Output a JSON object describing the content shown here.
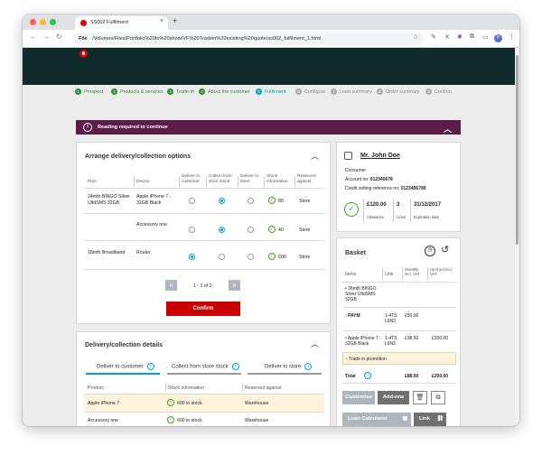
{
  "browser": {
    "tab_title": "SS002 Fulfilment",
    "tab_close": "×",
    "new_tab": "+",
    "url_scheme": "File",
    "url_path": "/Volumes/Files/Portfolio%20to%20show/VF%20Tradein%20existing%20quote/ss002_fulfilment_1.html",
    "profile_initial": "P"
  },
  "colors": {
    "header": "#0f2a2a",
    "alert": "#5c1c4a",
    "brand_red": "#e60000",
    "accent": "#00a3c4",
    "done": "#2e8b2e"
  },
  "steps": [
    {
      "num": "1",
      "label": "Prospect",
      "state": "done"
    },
    {
      "num": "2",
      "label": "Products & services",
      "state": "done"
    },
    {
      "num": "3",
      "label": "Trade-in",
      "state": "done"
    },
    {
      "num": "4",
      "label": "About the customer",
      "state": "done"
    },
    {
      "num": "5",
      "label": "Fulfilment",
      "state": "current"
    },
    {
      "num": "6",
      "label": "Configure",
      "state": "todo"
    },
    {
      "num": "7",
      "label": "Loan summary",
      "state": "todo"
    },
    {
      "num": "8",
      "label": "Order summary",
      "state": "todo"
    },
    {
      "num": "9",
      "label": "Confirm",
      "state": "todo"
    }
  ],
  "alert": {
    "icon": "!",
    "text": "Reading required to continue",
    "chevron": "︿"
  },
  "arrange": {
    "title": "Arrange delivery/collection options",
    "chevron": "︿",
    "headers": {
      "plan": "Plan",
      "device": "Device",
      "deliver_customer": "Deliver to customer",
      "collect_store": "Collect from store stock",
      "deliver_store": "Deliver to store",
      "stock": "Stock information",
      "reserved": "Reserved against"
    },
    "rows": [
      {
        "plan": "24mth BINGO Silver UltdSMS 32GB",
        "device": "Apple iPhone 7 - 32GB Black",
        "selected": "collect",
        "stock": "80",
        "reserved": "Store"
      },
      {
        "plan": "",
        "device": "Accessory one",
        "selected": "collect",
        "stock": "40",
        "reserved": "Store"
      },
      {
        "plan": "18mth Broadband",
        "device": "Router",
        "selected": "deliver_customer",
        "stock": "600",
        "reserved": "Store"
      }
    ],
    "pager": {
      "prev": "«",
      "text": "1 - 2 of 2",
      "next": "»"
    },
    "confirm_label": "Confirm"
  },
  "details": {
    "title": "Delivery/collection details",
    "chevron": "︿",
    "tabs": [
      "Deliver to customer",
      "Collect from store stock",
      "Deliver to store"
    ],
    "active_tab": 0,
    "headers": {
      "product": "Product",
      "stock": "Stock information",
      "reserved": "Reserved against"
    },
    "rows": [
      {
        "product": "Apple iPhone 7",
        "stock": "600 in stock",
        "reserved": "Warehouse"
      },
      {
        "product": "Accessory one",
        "stock": "600 in stock",
        "reserved": "Warehouse"
      }
    ]
  },
  "customer": {
    "name": "Mr. John Doe",
    "type": "Consumer",
    "account_label": "Account no:",
    "account_no": "012345678",
    "credit_label": "Credit  vetting reference no:",
    "credit_ref": "0123456789",
    "allowance_value": "£120.00",
    "allowance_label": "Allowance",
    "lines_value": "3",
    "lines_label": "Lines",
    "expiry_value": "31/12/2017",
    "expiry_label": "Expiration date"
  },
  "basket": {
    "title": "Basket",
    "headers": {
      "items": "Items",
      "link": "Link",
      "monthly": "Monthly incl. VAT",
      "upfront": "Up-front incl. VAT"
    },
    "items": [
      {
        "name": "36mth BINGO Silver UltdSMS 32GB",
        "link": "",
        "monthly": "",
        "upfront": ""
      },
      {
        "name": "PAYM",
        "link": "1-4TS L6N3",
        "monthly": "£50.00",
        "upfront": ""
      },
      {
        "name": "Apple iPhone 7 - 32GB Black",
        "link": "1-4TS L6N3",
        "monthly": "£38.50",
        "upfront": "£200.00"
      }
    ],
    "trade_in": "Trade in promotion",
    "total_label": "Total",
    "total_monthly": "£88.50",
    "total_upfront": "£200.00",
    "buttons": {
      "customise": "Customise",
      "addons": "Add-ons",
      "loan": "Loan Calculator",
      "link": "Link"
    }
  }
}
